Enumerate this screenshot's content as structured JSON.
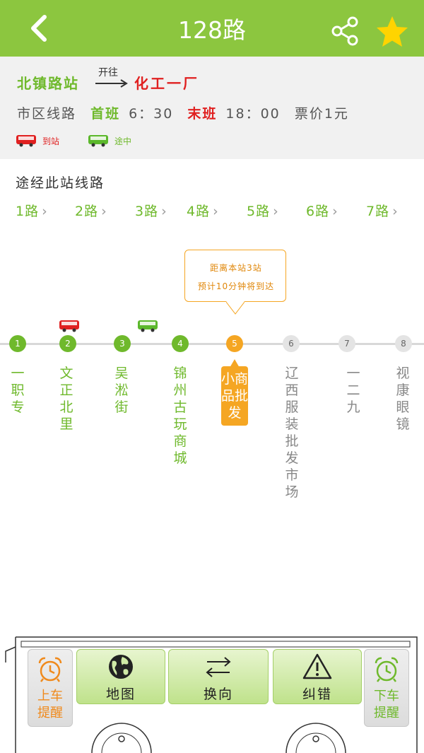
{
  "header": {
    "title": "128路"
  },
  "info": {
    "from_stop": "北镇路站",
    "direction_label": "开往",
    "to_stop": "化工一厂",
    "line_type": "市区线路",
    "first_label": "首班",
    "first_time": "6：30",
    "last_label": "末班",
    "last_time": "18：00",
    "fare": "票价1元",
    "legend": [
      {
        "label": "到站",
        "color": "#e02020"
      },
      {
        "label": "途中",
        "color": "#6fb92c"
      }
    ]
  },
  "via": {
    "title": "途经此站线路",
    "routes": [
      "1路",
      "2路",
      "3路",
      "4路",
      "5路",
      "6路",
      "7路"
    ]
  },
  "tooltip": {
    "line1": "距离本站3站",
    "line2": "预计10分钟将到达"
  },
  "stops": [
    {
      "num": "1",
      "name": "一职专",
      "state": "passed"
    },
    {
      "num": "2",
      "name": "文正北里",
      "state": "passed"
    },
    {
      "num": "3",
      "name": "吴淞街",
      "state": "passed"
    },
    {
      "num": "4",
      "name": "锦州古玩商城",
      "state": "passed"
    },
    {
      "num": "5",
      "name": "小商品批发",
      "state": "current"
    },
    {
      "num": "6",
      "name": "辽西服装批发市场",
      "state": "upcoming"
    },
    {
      "num": "7",
      "name": "一二九",
      "state": "upcoming"
    },
    {
      "num": "8",
      "name": "视康眼镜",
      "state": "upcoming"
    }
  ],
  "toolbar": {
    "board_alarm": "上车提醒",
    "map": "地图",
    "reverse": "换向",
    "report_error": "纠错",
    "alight_alarm": "下车提醒"
  },
  "icons": {
    "back": "chevron-left-icon",
    "share": "share-icon",
    "favorite": "star-icon",
    "map": "globe-icon",
    "reverse": "swap-arrows-icon",
    "report_error": "warning-icon",
    "alarm": "alarm-clock-icon"
  },
  "colors": {
    "brand_green": "#8cc63f",
    "accent_orange": "#f5a623",
    "arrive_red": "#e02020",
    "star_yellow": "#ffd400"
  }
}
